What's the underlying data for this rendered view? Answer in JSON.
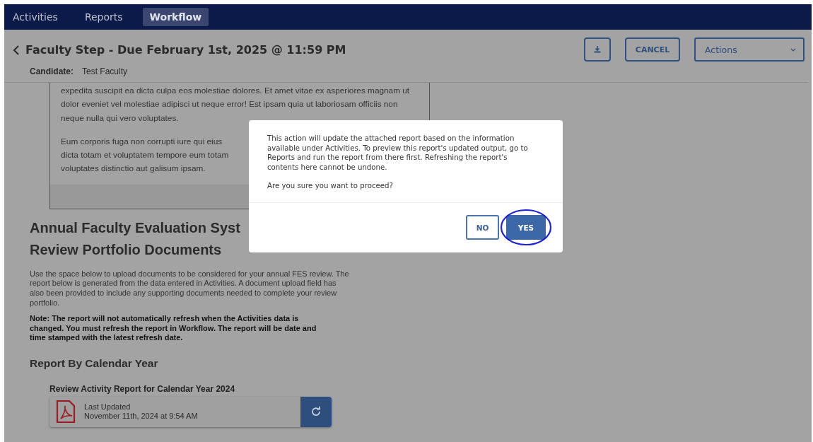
{
  "nav": {
    "tabs": [
      {
        "label": "Activities",
        "selected": false
      },
      {
        "label": "Reports",
        "selected": false
      },
      {
        "label": "Workflow",
        "selected": true
      }
    ]
  },
  "header": {
    "title": "Faculty Step - Due February 1st, 2025 @ 11:59 PM",
    "candidate_label": "Candidate:",
    "candidate_value": "Test Faculty",
    "cancel": "CANCEL",
    "actions": "Actions"
  },
  "document_excerpt": {
    "paragraphs": [
      "expedita suscipit ea dicta culpa eos molestiae dolores. Et amet vitae ex asperiores magnam ut\ndolor eveniet vel molestiae adipisci ut neque error! Est ipsam quia ut laboriosam officiis non\nneque nulla qui vero voluptates.",
      "Eum corporis fuga non corrupti iure qui eius\ndicta totam et voluptatem tempore eum totam\nvoluptates distinctio aut galisum ipsam."
    ]
  },
  "section": {
    "heading_lines": [
      "Annual Faculty Evaluation Syst",
      "Review Portfolio Documents"
    ],
    "description": "Use the space below to upload documents to be considered for your annual FES review. The report below is generated from the data entered in Activities. A document upload field has also been provided to include any supporting documents needed to complete your review portfolio.",
    "note": "Note:  The report will not automatically refresh when the Activities data is changed. You must refresh the report in Workflow. The report will be date and time stamped with the latest refresh date.",
    "subheading": "Report By Calendar Year",
    "report": {
      "title": "Review Activity Report for Calendar Year 2024",
      "status_label": "Last Updated",
      "updated": "November 11th, 2024 at 9:54 AM"
    }
  },
  "dialog": {
    "message": "This action will update the attached report based on the information available under Activities. To preview this report's updated output, go to Reports and run the report from there first. Refreshing the report's contents here cannot be undone.",
    "question": "Are you sure you want to proceed?",
    "buttons": [
      {
        "label": "NO",
        "kind": "secondary",
        "circled": false
      },
      {
        "label": "YES",
        "kind": "primary",
        "circled": true
      }
    ]
  }
}
